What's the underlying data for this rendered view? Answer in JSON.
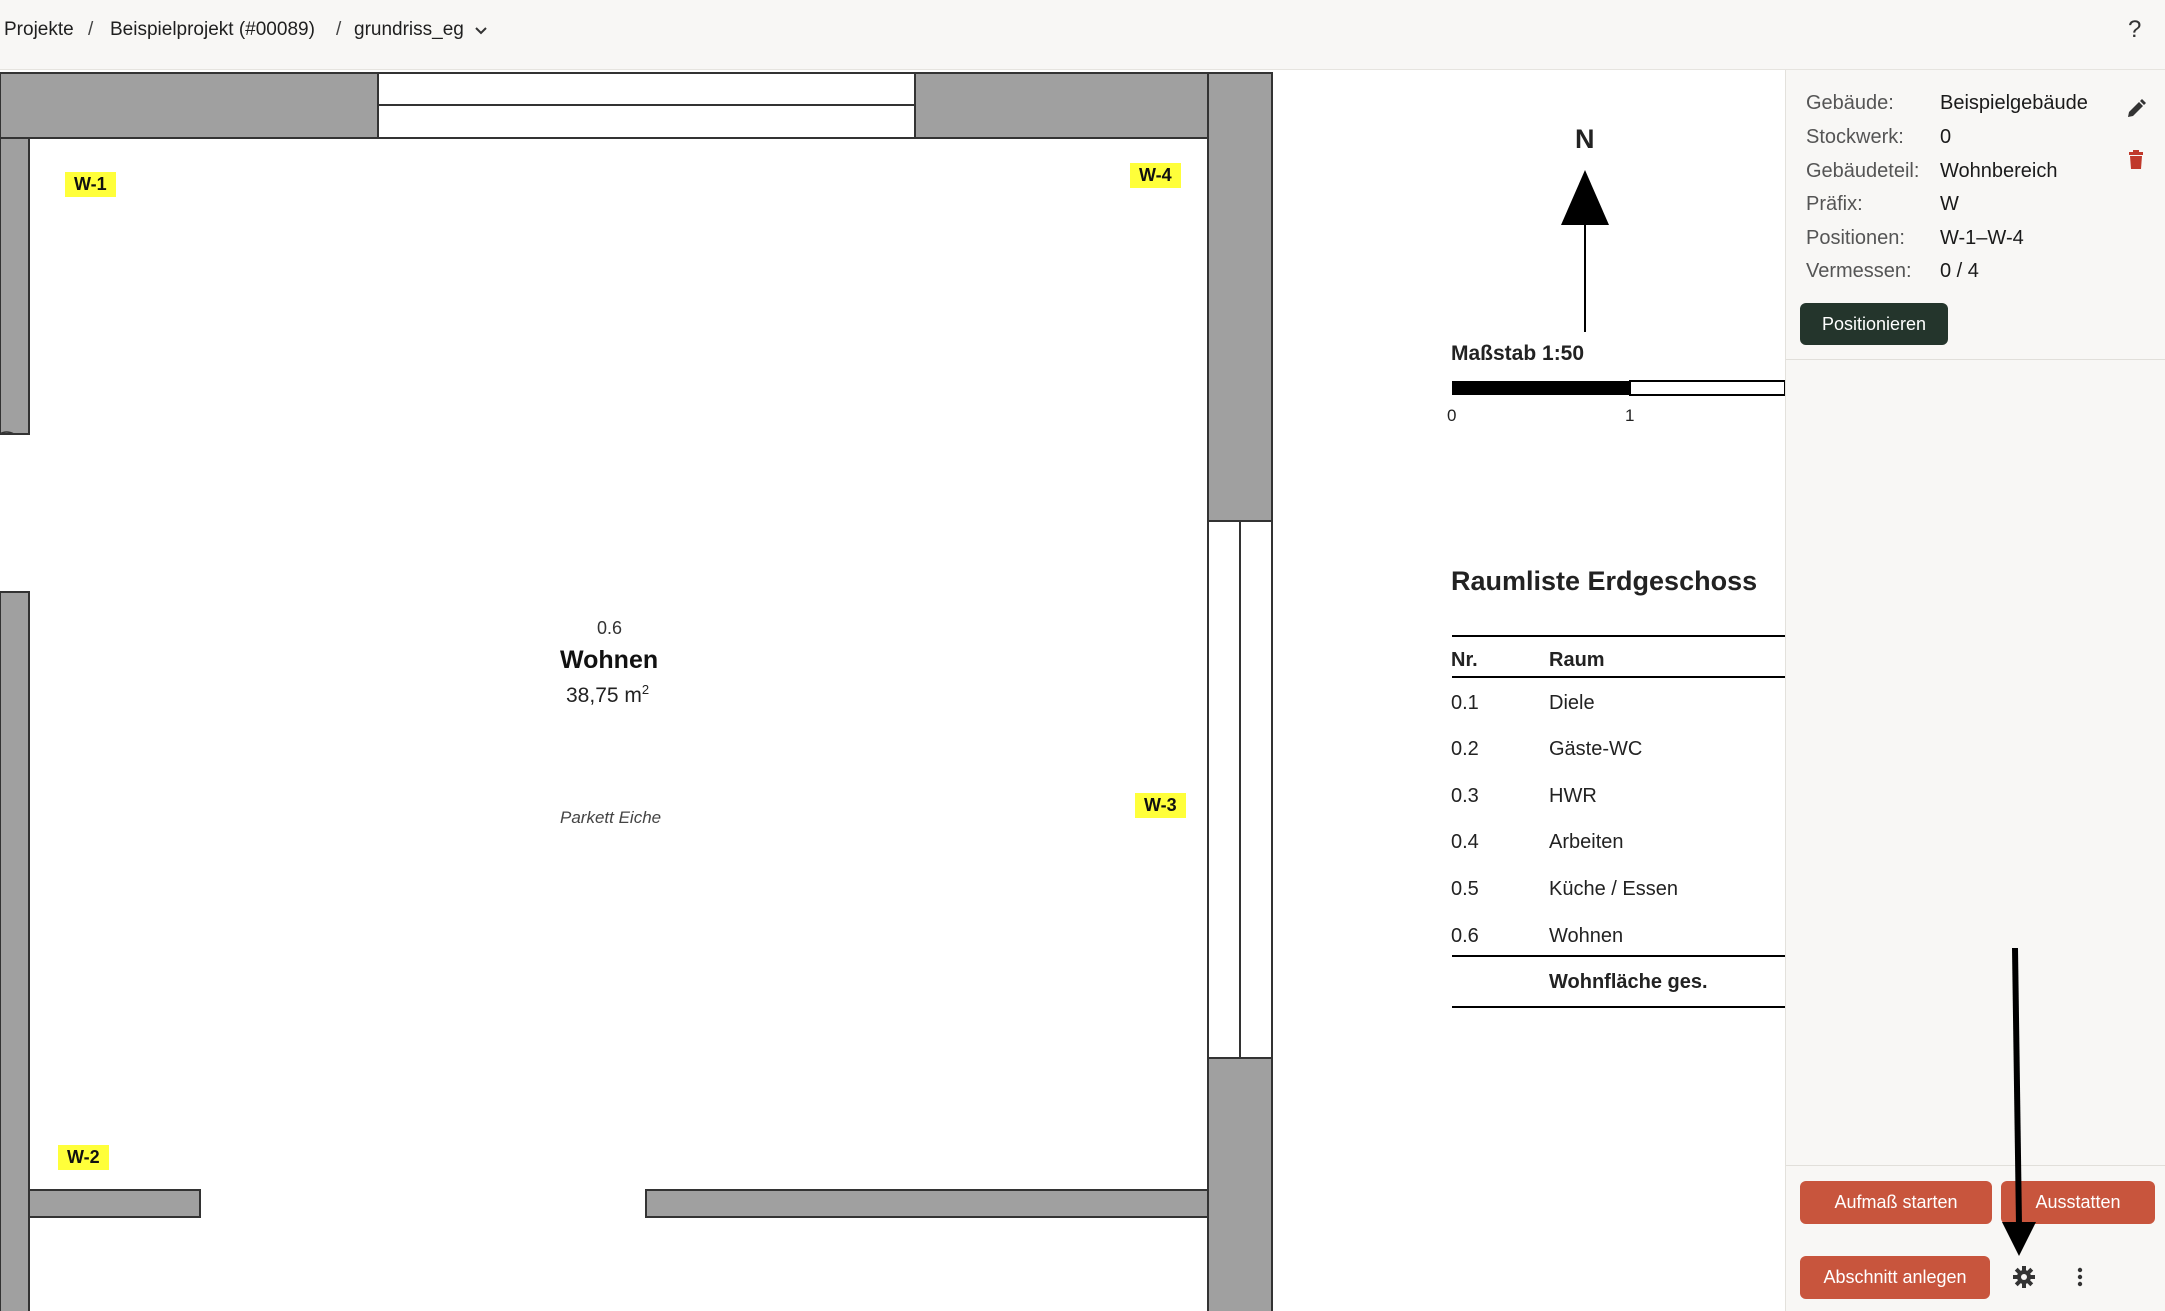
{
  "breadcrumb": {
    "items": [
      "Projekte",
      "Beispielprojekt (#00089)",
      "grundriss_eg"
    ],
    "separator": "/"
  },
  "help_label": "?",
  "plan": {
    "markers": [
      "W-1",
      "W-2",
      "W-3",
      "W-4"
    ],
    "room": {
      "nr": "0.6",
      "name": "Wohnen",
      "area": "38,75 m",
      "area_unit_sup": "2",
      "floor": "Parkett Eiche"
    },
    "north_label": "N",
    "scale": {
      "title": "Maßstab 1:50",
      "ticks": [
        "0",
        "1"
      ]
    },
    "room_list": {
      "title": "Raumliste Erdgeschoss",
      "headers": [
        "Nr.",
        "Raum"
      ],
      "rows": [
        {
          "nr": "0.1",
          "raum": "Diele"
        },
        {
          "nr": "0.2",
          "raum": "Gäste-WC"
        },
        {
          "nr": "0.3",
          "raum": "HWR"
        },
        {
          "nr": "0.4",
          "raum": "Arbeiten"
        },
        {
          "nr": "0.5",
          "raum": "Küche / Essen"
        },
        {
          "nr": "0.6",
          "raum": "Wohnen"
        }
      ],
      "total_label": "Wohnfläche ges."
    }
  },
  "panel": {
    "info": [
      {
        "label": "Gebäude:",
        "value": "Beispielgebäude"
      },
      {
        "label": "Stockwerk:",
        "value": "0"
      },
      {
        "label": "Gebäudeteil:",
        "value": "Wohnbereich"
      },
      {
        "label": "Präfix:",
        "value": "W"
      },
      {
        "label": "Positionen:",
        "value": "W-1–W-4"
      },
      {
        "label": "Vermessen:",
        "value": "0 / 4"
      }
    ],
    "position_button": "Positionieren",
    "actions": {
      "aufmass": "Aufmaß starten",
      "ausstatten": "Ausstatten",
      "abschnitt": "Abschnitt anlegen"
    },
    "icons": {
      "edit": "pencil-icon",
      "delete": "trash-icon",
      "settings": "gear-icon",
      "more": "kebab-menu-icon"
    }
  },
  "colors": {
    "accent_dark": "#24352c",
    "action_red": "#c8553d",
    "marker_yellow": "#ffff3a",
    "wall_gray": "#a0a0a0",
    "delete_red": "#c0392b"
  }
}
